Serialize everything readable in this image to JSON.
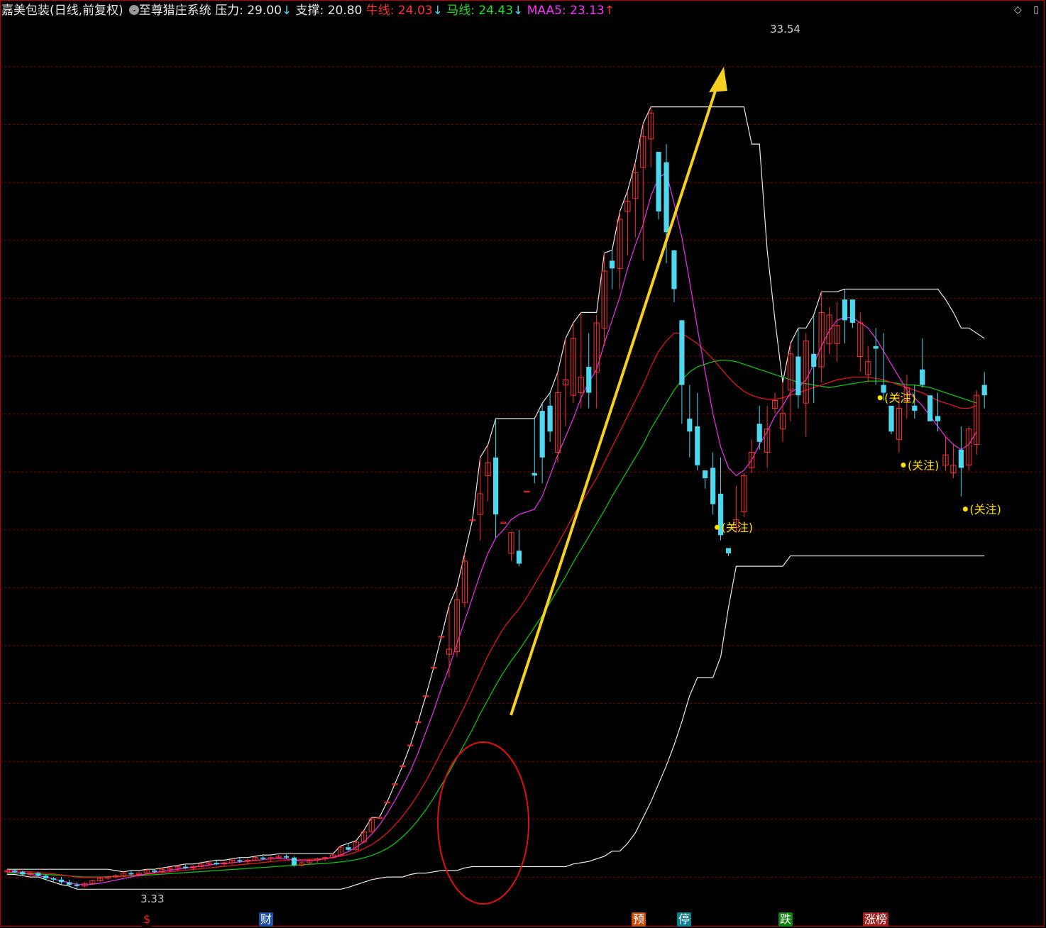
{
  "header": {
    "stock_name": "嘉美包装(日线,前复权)",
    "indicator_name": "至尊猎庄系统",
    "pressure_label": "压力:",
    "pressure_value": "29.00",
    "support_label": "支撑:",
    "support_value": "20.80",
    "bull_label": "牛线:",
    "bull_value": "24.03",
    "horse_label": "马线:",
    "horse_value": "24.43",
    "maa5_label": "MAA5:",
    "maa5_value": "23.13",
    "arrow_down": "↓",
    "arrow_up": "↑"
  },
  "top_right": {
    "diamond": "◇",
    "menu": "▯"
  },
  "colors": {
    "up": "#ff3030",
    "down": "#4dd8f0",
    "white_line": "#e8e8e8",
    "bull": "#e01818",
    "horse": "#10c010",
    "maa5": "#e030e0",
    "arrow": "#f5d020",
    "grid": "#8a0000",
    "focus": "#ffe000"
  },
  "bottom_badges": [
    {
      "text": "$",
      "color": "#ff2020",
      "bg": "#000000"
    },
    {
      "text": "财",
      "color": "#ffffff",
      "bg": "#2050a0"
    },
    {
      "text": "预",
      "color": "#ffffff",
      "bg": "#c05010"
    },
    {
      "text": "停",
      "color": "#ffffff",
      "bg": "#108090"
    },
    {
      "text": "跌",
      "color": "#ffffff",
      "bg": "#108010"
    },
    {
      "text": "涨榜",
      "color": "#ffffff",
      "bg": "#a02020"
    }
  ],
  "chart_data": {
    "type": "candlestick",
    "title": "嘉美包装(日线,前复权)",
    "y_range": [
      2.5,
      34.8
    ],
    "grid": "horizontal dashed",
    "max_label": "33.54",
    "min_label": "3.33",
    "focus_label": "(关注)",
    "candles": [
      [
        4.0,
        4.1,
        3.9,
        4.05
      ],
      [
        4.05,
        4.1,
        3.95,
        4.0
      ],
      [
        4.0,
        4.05,
        3.85,
        3.9
      ],
      [
        3.9,
        4.0,
        3.8,
        3.95
      ],
      [
        3.95,
        4.0,
        3.8,
        3.85
      ],
      [
        3.85,
        3.9,
        3.7,
        3.75
      ],
      [
        3.75,
        3.8,
        3.6,
        3.7
      ],
      [
        3.7,
        3.8,
        3.5,
        3.6
      ],
      [
        3.6,
        3.7,
        3.45,
        3.5
      ],
      [
        3.5,
        3.6,
        3.33,
        3.45
      ],
      [
        3.45,
        3.6,
        3.4,
        3.55
      ],
      [
        3.55,
        3.7,
        3.5,
        3.65
      ],
      [
        3.65,
        3.8,
        3.6,
        3.75
      ],
      [
        3.75,
        3.85,
        3.7,
        3.8
      ],
      [
        3.8,
        3.9,
        3.75,
        3.85
      ],
      [
        3.85,
        4.0,
        3.8,
        3.95
      ],
      [
        3.95,
        4.05,
        3.85,
        3.9
      ],
      [
        3.9,
        4.0,
        3.8,
        3.95
      ],
      [
        3.95,
        4.1,
        3.9,
        4.05
      ],
      [
        4.05,
        4.1,
        3.95,
        4.0
      ],
      [
        4.0,
        4.15,
        3.95,
        4.1
      ],
      [
        4.1,
        4.2,
        4.0,
        4.15
      ],
      [
        4.15,
        4.25,
        4.05,
        4.2
      ],
      [
        4.2,
        4.3,
        4.1,
        4.15
      ],
      [
        4.15,
        4.25,
        4.05,
        4.2
      ],
      [
        4.2,
        4.35,
        4.15,
        4.3
      ],
      [
        4.3,
        4.4,
        4.2,
        4.35
      ],
      [
        4.35,
        4.45,
        4.25,
        4.3
      ],
      [
        4.3,
        4.4,
        4.2,
        4.35
      ],
      [
        4.35,
        4.5,
        4.3,
        4.45
      ],
      [
        4.45,
        4.55,
        4.35,
        4.4
      ],
      [
        4.4,
        4.5,
        4.3,
        4.45
      ],
      [
        4.45,
        4.6,
        4.4,
        4.55
      ],
      [
        4.55,
        4.65,
        4.45,
        4.5
      ],
      [
        4.5,
        4.6,
        4.4,
        4.55
      ],
      [
        4.55,
        4.7,
        4.5,
        4.6
      ],
      [
        4.6,
        4.7,
        4.5,
        4.55
      ],
      [
        4.55,
        4.6,
        4.2,
        4.25
      ],
      [
        4.25,
        4.4,
        4.2,
        4.35
      ],
      [
        4.35,
        4.5,
        4.3,
        4.45
      ],
      [
        4.45,
        4.55,
        4.35,
        4.5
      ],
      [
        4.5,
        4.6,
        4.4,
        4.55
      ],
      [
        4.55,
        4.7,
        4.5,
        4.65
      ],
      [
        4.65,
        5.0,
        4.6,
        4.95
      ],
      [
        4.95,
        5.1,
        4.8,
        4.85
      ],
      [
        4.85,
        5.2,
        4.8,
        5.15
      ],
      [
        5.15,
        5.6,
        5.1,
        5.55
      ],
      [
        5.55,
        6.1,
        5.5,
        6.05
      ],
      [
        6.1,
        6.1,
        6.1,
        6.1
      ],
      [
        6.7,
        6.7,
        6.7,
        6.7
      ],
      [
        7.4,
        7.4,
        7.4,
        7.4
      ],
      [
        8.1,
        8.1,
        8.1,
        8.1
      ],
      [
        8.9,
        8.9,
        8.9,
        8.9
      ],
      [
        9.8,
        9.8,
        9.8,
        9.8
      ],
      [
        10.8,
        10.8,
        10.8,
        10.8
      ],
      [
        11.9,
        11.9,
        11.9,
        11.9
      ],
      [
        13.1,
        13.1,
        13.1,
        13.1
      ],
      [
        12.4,
        14.3,
        11.5,
        12.6
      ],
      [
        12.5,
        15.0,
        12.3,
        14.5
      ],
      [
        14.4,
        16.3,
        14.2,
        16.0
      ],
      [
        17.6,
        17.6,
        17.6,
        17.6
      ],
      [
        17.8,
        20.0,
        16.8,
        18.6
      ],
      [
        19.3,
        20.5,
        18.3,
        19.8
      ],
      [
        20.0,
        21.5,
        16.9,
        17.8
      ],
      [
        17.5,
        17.5,
        17.5,
        17.5
      ],
      [
        16.3,
        17.1,
        16.0,
        17.1
      ],
      [
        16.4,
        17.2,
        15.8,
        15.9
      ],
      [
        18.7,
        18.7,
        18.7,
        18.7
      ],
      [
        19.4,
        21.5,
        19.0,
        19.3
      ],
      [
        21.8,
        22.1,
        19.0,
        20.0
      ],
      [
        22.0,
        22.5,
        20.6,
        21.0
      ],
      [
        20.2,
        23.3,
        19.8,
        22.5
      ],
      [
        22.8,
        24.6,
        21.2,
        23.0
      ],
      [
        22.4,
        25.2,
        22.1,
        24.6
      ],
      [
        22.5,
        25.6,
        21.9,
        23.1
      ],
      [
        23.5,
        24.8,
        21.9,
        22.5
      ],
      [
        23.3,
        25.5,
        21.9,
        25.2
      ],
      [
        25.0,
        27.9,
        24.3,
        27.2
      ],
      [
        27.6,
        28.0,
        26.5,
        27.3
      ],
      [
        27.3,
        29.5,
        26.5,
        29.2
      ],
      [
        29.5,
        30.3,
        27.8,
        29.9
      ],
      [
        30.0,
        31.4,
        28.5,
        31.0
      ],
      [
        31.2,
        32.9,
        27.6,
        32.4
      ],
      [
        32.3,
        33.54,
        31.2,
        33.3
      ],
      [
        31.8,
        31.8,
        29.2,
        29.5
      ],
      [
        31.4,
        32.1,
        27.5,
        28.7
      ],
      [
        28.0,
        28.0,
        26.0,
        26.5
      ],
      [
        25.3,
        25.3,
        21.3,
        22.8
      ],
      [
        21.5,
        22.8,
        20.0,
        21.0
      ],
      [
        21.2,
        22.5,
        19.5,
        19.7
      ],
      [
        19.5,
        19.5,
        18.8,
        19.2
      ],
      [
        19.6,
        20.2,
        17.8,
        18.2
      ],
      [
        18.6,
        20.0,
        16.8,
        17.0
      ],
      [
        16.5,
        16.5,
        16.2,
        16.3
      ],
      [
        17.3,
        18.9,
        17.1,
        17.6
      ],
      [
        17.9,
        19.4,
        17.7,
        19.3
      ],
      [
        19.6,
        20.7,
        19.4,
        20.2
      ],
      [
        21.3,
        22.0,
        20.3,
        20.6
      ],
      [
        20.2,
        22.0,
        19.6,
        21.1
      ],
      [
        21.9,
        22.5,
        21.7,
        22.2
      ],
      [
        21.1,
        22.9,
        20.6,
        21.7
      ],
      [
        22.6,
        24.4,
        21.4,
        24.0
      ],
      [
        23.9,
        25.0,
        21.9,
        22.4
      ],
      [
        22.1,
        24.8,
        20.8,
        24.5
      ],
      [
        24.0,
        25.5,
        22.1,
        23.5
      ],
      [
        23.5,
        26.4,
        22.9,
        25.6
      ],
      [
        24.4,
        25.8,
        24.0,
        25.5
      ],
      [
        24.4,
        26.0,
        23.7,
        25.1
      ],
      [
        26.1,
        26.5,
        24.4,
        25.3
      ],
      [
        26.1,
        26.1,
        25.0,
        25.2
      ],
      [
        23.9,
        25.6,
        23.3,
        25.2
      ],
      [
        23.2,
        24.3,
        22.9,
        23.7
      ],
      [
        24.3,
        25.0,
        22.8,
        24.2
      ],
      [
        22.8,
        24.8,
        22.2,
        22.5
      ],
      [
        22.0,
        22.0,
        20.9,
        21.0
      ],
      [
        20.7,
        22.5,
        20.2,
        21.9
      ],
      [
        22.2,
        23.2,
        21.5,
        22.7
      ],
      [
        22.0,
        22.8,
        21.5,
        21.8
      ],
      [
        23.4,
        24.6,
        22.7,
        22.8
      ],
      [
        22.4,
        22.4,
        21.5,
        21.4
      ],
      [
        21.6,
        22.5,
        21.0,
        21.4
      ],
      [
        19.7,
        20.8,
        19.5,
        20.1
      ],
      [
        19.4,
        20.5,
        19.2,
        19.7
      ],
      [
        20.3,
        21.2,
        18.5,
        19.6
      ],
      [
        19.7,
        21.2,
        19.5,
        21.1
      ],
      [
        20.5,
        22.6,
        20.1,
        22.4
      ],
      [
        22.8,
        23.3,
        21.9,
        22.4
      ]
    ],
    "bull_line": [
      4.05,
      4.04,
      4.02,
      4.0,
      3.98,
      3.95,
      3.92,
      3.88,
      3.84,
      3.8,
      3.78,
      3.78,
      3.79,
      3.8,
      3.82,
      3.84,
      3.86,
      3.88,
      3.91,
      3.94,
      3.97,
      4.0,
      4.03,
      4.06,
      4.09,
      4.12,
      4.15,
      4.18,
      4.21,
      4.24,
      4.27,
      4.3,
      4.33,
      4.36,
      4.39,
      4.42,
      4.45,
      4.46,
      4.47,
      4.48,
      4.5,
      4.52,
      4.55,
      4.6,
      4.67,
      4.76,
      4.89,
      5.05,
      5.25,
      5.5,
      5.8,
      6.15,
      6.55,
      7.0,
      7.5,
      8.05,
      8.65,
      9.2,
      9.8,
      10.4,
      11.05,
      11.7,
      12.35,
      12.9,
      13.4,
      13.8,
      14.15,
      14.6,
      15.1,
      15.6,
      16.1,
      16.65,
      17.2,
      17.75,
      18.25,
      18.7,
      19.2,
      19.8,
      20.4,
      21.0,
      21.6,
      22.2,
      22.8,
      23.5,
      24.1,
      24.5,
      24.8,
      24.8,
      24.6,
      24.4,
      24.1,
      23.8,
      23.45,
      23.1,
      22.8,
      22.55,
      22.4,
      22.3,
      22.25,
      22.25,
      22.3,
      22.4,
      22.5,
      22.6,
      22.7,
      22.8,
      22.9,
      23.0,
      23.05,
      23.1,
      23.1,
      23.1,
      23.05,
      23.0,
      22.9,
      22.8,
      22.7,
      22.6,
      22.5,
      22.35,
      22.2,
      22.1,
      22.0,
      21.9,
      21.9,
      22.0
    ],
    "horse_line": [
      3.95,
      3.95,
      3.94,
      3.93,
      3.92,
      3.9,
      3.88,
      3.86,
      3.84,
      3.82,
      3.8,
      3.8,
      3.8,
      3.81,
      3.82,
      3.83,
      3.84,
      3.85,
      3.87,
      3.89,
      3.91,
      3.93,
      3.95,
      3.97,
      3.99,
      4.01,
      4.03,
      4.05,
      4.07,
      4.09,
      4.11,
      4.13,
      4.15,
      4.17,
      4.19,
      4.21,
      4.23,
      4.25,
      4.27,
      4.29,
      4.31,
      4.33,
      4.35,
      4.38,
      4.42,
      4.47,
      4.54,
      4.63,
      4.75,
      4.9,
      5.1,
      5.35,
      5.65,
      6.0,
      6.4,
      6.85,
      7.35,
      7.85,
      8.4,
      8.95,
      9.5,
      10.1,
      10.65,
      11.2,
      11.7,
      12.15,
      12.55,
      13.0,
      13.45,
      13.9,
      14.4,
      14.9,
      15.4,
      15.95,
      16.45,
      16.95,
      17.45,
      17.95,
      18.5,
      19.0,
      19.5,
      20.0,
      20.5,
      21.1,
      21.6,
      22.1,
      22.6,
      23.0,
      23.3,
      23.5,
      23.6,
      23.7,
      23.75,
      23.75,
      23.7,
      23.6,
      23.5,
      23.4,
      23.3,
      23.2,
      23.1,
      23.0,
      22.9,
      22.85,
      22.8,
      22.75,
      22.7,
      22.75,
      22.8,
      22.85,
      22.9,
      22.95,
      22.95,
      22.95,
      22.9,
      22.85,
      22.8,
      22.8,
      22.75,
      22.7,
      22.6,
      22.5,
      22.4,
      22.3,
      22.2,
      22.1
    ],
    "maa5_line": [
      4.0,
      3.98,
      3.95,
      3.9,
      3.85,
      3.8,
      3.72,
      3.65,
      3.58,
      3.52,
      3.5,
      3.52,
      3.56,
      3.62,
      3.68,
      3.74,
      3.8,
      3.86,
      3.92,
      3.98,
      4.02,
      4.06,
      4.1,
      4.14,
      4.18,
      4.22,
      4.26,
      4.3,
      4.32,
      4.35,
      4.38,
      4.41,
      4.44,
      4.47,
      4.5,
      4.52,
      4.5,
      4.45,
      4.42,
      4.43,
      4.46,
      4.5,
      4.56,
      4.65,
      4.78,
      4.95,
      5.15,
      5.45,
      5.8,
      6.25,
      6.75,
      7.3,
      7.9,
      8.6,
      9.4,
      10.2,
      11.1,
      11.9,
      12.8,
      13.7,
      14.6,
      15.5,
      16.3,
      16.9,
      17.2,
      17.6,
      17.8,
      17.9,
      18.0,
      18.5,
      19.3,
      20.1,
      20.8,
      21.5,
      22.3,
      22.9,
      23.4,
      24.4,
      25.3,
      26.2,
      27.3,
      28.2,
      29.0,
      30.1,
      30.8,
      31.0,
      29.8,
      28.5,
      26.8,
      25.0,
      23.3,
      21.7,
      20.4,
      19.6,
      19.3,
      19.5,
      19.9,
      20.5,
      21.0,
      21.6,
      22.0,
      22.5,
      22.7,
      23.0,
      23.6,
      24.3,
      24.9,
      25.3,
      25.4,
      25.4,
      25.2,
      25.0,
      24.6,
      24.1,
      23.6,
      23.1,
      22.6,
      22.3,
      22.0,
      21.6,
      21.2,
      20.8,
      20.5,
      20.3,
      20.5,
      21.0
    ],
    "pressure_line": "stepwise",
    "support_line": "stepwise",
    "focus_markers": [
      91,
      112,
      115,
      123
    ]
  }
}
